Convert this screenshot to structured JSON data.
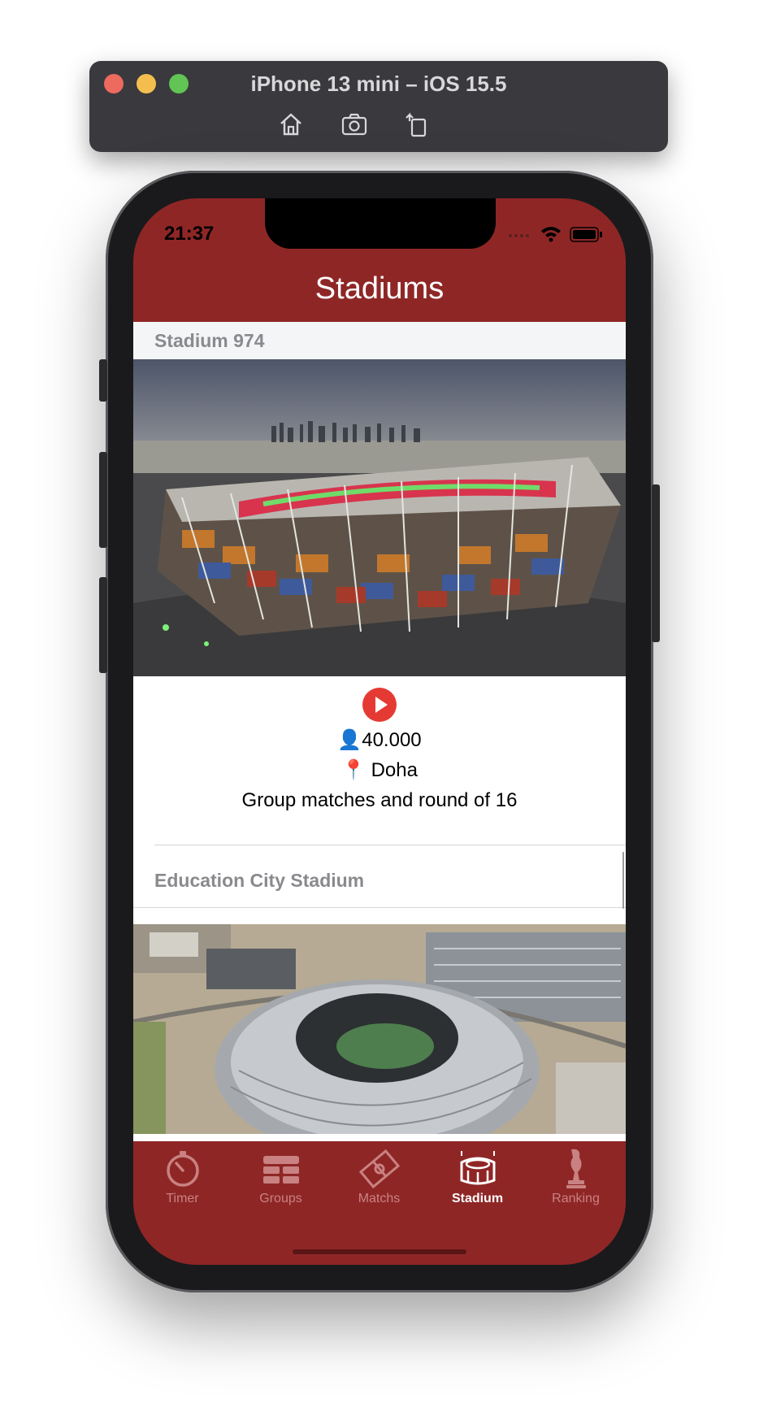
{
  "simulator": {
    "title": "iPhone 13 mini – iOS 15.5",
    "tools": [
      "home-icon",
      "screenshot-icon",
      "rotate-icon"
    ]
  },
  "status_bar": {
    "time": "21:37"
  },
  "nav": {
    "title": "Stadiums"
  },
  "stadiums": [
    {
      "name": "Stadium 974",
      "capacity": "👤40.000",
      "city": "📍 Doha",
      "stage": "Group matches and round of 16"
    },
    {
      "name": "Education City Stadium"
    }
  ],
  "tabs": [
    {
      "label": "Timer",
      "icon": "stopwatch-icon",
      "active": false
    },
    {
      "label": "Groups",
      "icon": "groups-icon",
      "active": false
    },
    {
      "label": "Matchs",
      "icon": "pitch-icon",
      "active": false
    },
    {
      "label": "Stadium",
      "icon": "stadium-icon",
      "active": true
    },
    {
      "label": "Ranking",
      "icon": "trophy-icon",
      "active": false
    }
  ],
  "colors": {
    "accent": "#8f2626",
    "play_button": "#e53a33",
    "tab_inactive": "#c98181",
    "tab_active": "#ffffff"
  }
}
